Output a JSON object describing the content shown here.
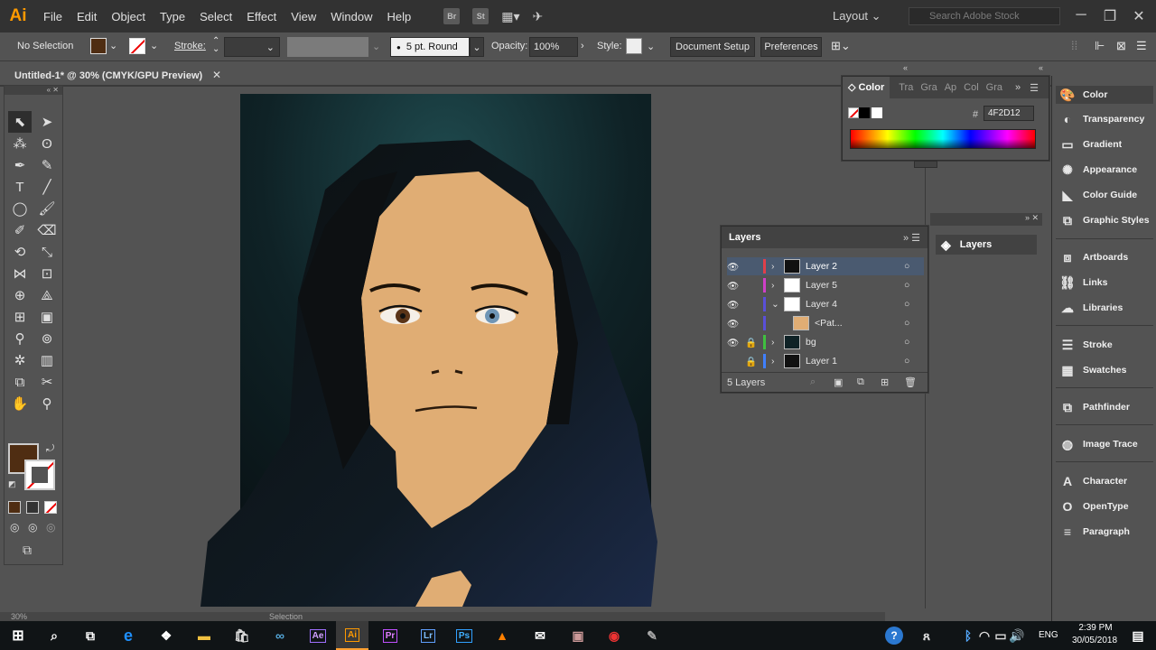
{
  "app": {
    "logo": "Ai"
  },
  "menu": [
    "File",
    "Edit",
    "Object",
    "Type",
    "Select",
    "Effect",
    "View",
    "Window",
    "Help"
  ],
  "menubar_tiles": [
    "Br",
    "St"
  ],
  "workspace": {
    "label": "Layout",
    "search_placeholder": "Search Adobe Stock"
  },
  "control": {
    "selection": "No Selection",
    "fill_color": "#4F2D12",
    "stroke_label": "Stroke:",
    "brush": "5 pt. Round",
    "opacity_label": "Opacity:",
    "opacity_value": "100%",
    "style_label": "Style:",
    "doc_setup": "Document Setup",
    "preferences": "Preferences"
  },
  "document": {
    "tab_title": "Untitled-1* @ 30% (CMYK/GPU Preview)"
  },
  "color_panel": {
    "tabs": [
      "Color",
      "Tra",
      "Gra",
      "Ap",
      "Col",
      "Gra"
    ],
    "hex_symbol": "#",
    "hex_value": "4F2D12"
  },
  "layers_panel": {
    "title": "Layers",
    "count": "5 Layers",
    "rows": [
      {
        "name": "Layer 2",
        "color": "#e0404a",
        "selected": true
      },
      {
        "name": "Layer 5",
        "color": "#d040c8",
        "selected": false
      },
      {
        "name": "Layer 4",
        "color": "#5a50d8",
        "selected": false
      },
      {
        "name": "<Pat...",
        "color": "#5a50d8",
        "selected": false
      },
      {
        "name": "bg",
        "color": "#40c040",
        "selected": false
      },
      {
        "name": "Layer 1",
        "color": "#4080ff",
        "selected": false
      }
    ]
  },
  "collapsed_layers": {
    "label": "Layers"
  },
  "right_dock": [
    "Color",
    "Transparency",
    "Gradient",
    "Appearance",
    "Color Guide",
    "Graphic Styles",
    "Artboards",
    "Links",
    "Libraries",
    "Stroke",
    "Swatches",
    "Pathfinder",
    "Image Trace",
    "Character",
    "OpenType",
    "Paragraph"
  ],
  "status": {
    "zoom": "30%",
    "mode": "Selection"
  },
  "taskbar": {
    "apps": [
      "Ae",
      "Ai",
      "Pr",
      "Lr",
      "Ps"
    ],
    "time": "2:39 PM",
    "date": "30/05/2018",
    "lang": "ENG"
  }
}
